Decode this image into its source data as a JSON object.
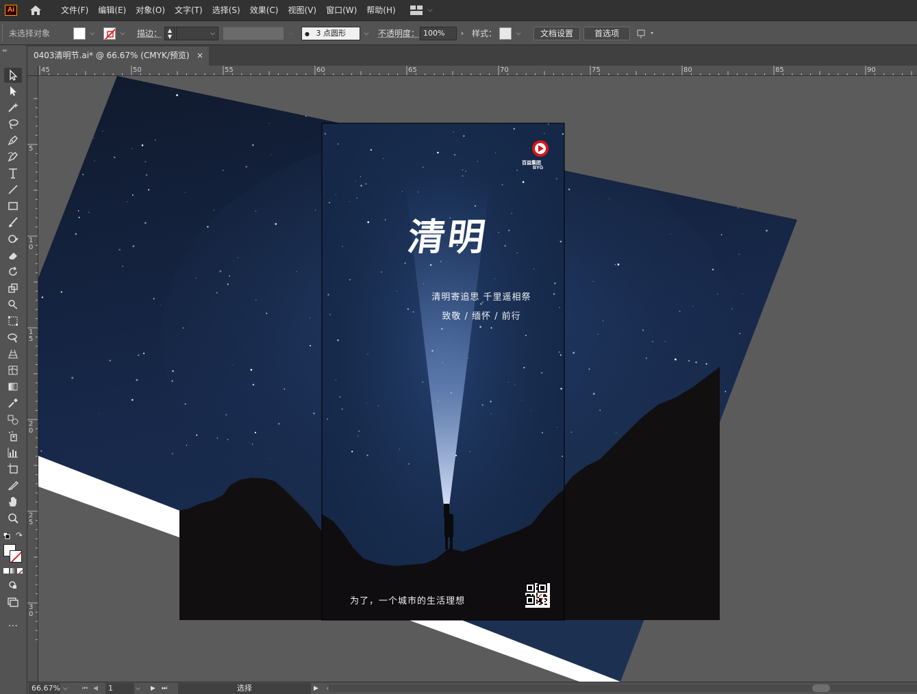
{
  "app": {
    "logo_text": "Ai",
    "menu": [
      "文件(F)",
      "编辑(E)",
      "对象(O)",
      "文字(T)",
      "选择(S)",
      "效果(C)",
      "视图(V)",
      "窗口(W)",
      "帮助(H)"
    ]
  },
  "controlbar": {
    "selection_label": "未选择对象",
    "stroke_label": "描边：",
    "brush_label": "3 点圆形",
    "opacity_label": "不透明度：",
    "opacity_value": "100%",
    "style_label": "样式：",
    "doc_setup": "文档设置",
    "preferences": "首选项"
  },
  "tab": {
    "title": "0403清明节.ai* @ 66.67% (CMYK/预览)",
    "close": "×"
  },
  "ruler": {
    "top_labels": [
      "45",
      "50",
      "55",
      "60",
      "65",
      "70",
      "75",
      "80",
      "85",
      "90"
    ],
    "left_labels": [
      "5",
      "10",
      "15",
      "20",
      "25",
      "30"
    ]
  },
  "poster": {
    "title": "清明",
    "subtitle1": "清明寄追思 千里遥相祭",
    "subtitle2": "致敬 / 缅怀 / 前行",
    "footer": "为了，一个城市的生活理想",
    "brand_cn": "百益集团",
    "brand_en": "BYG"
  },
  "statusbar": {
    "zoom": "66.67%",
    "page": "1",
    "mode": "选择"
  },
  "colors": {
    "accent": "#ff9a00",
    "brand_red": "#d7151b",
    "sky_top": "#0f1a2c",
    "sky_bottom": "#1d3556"
  }
}
